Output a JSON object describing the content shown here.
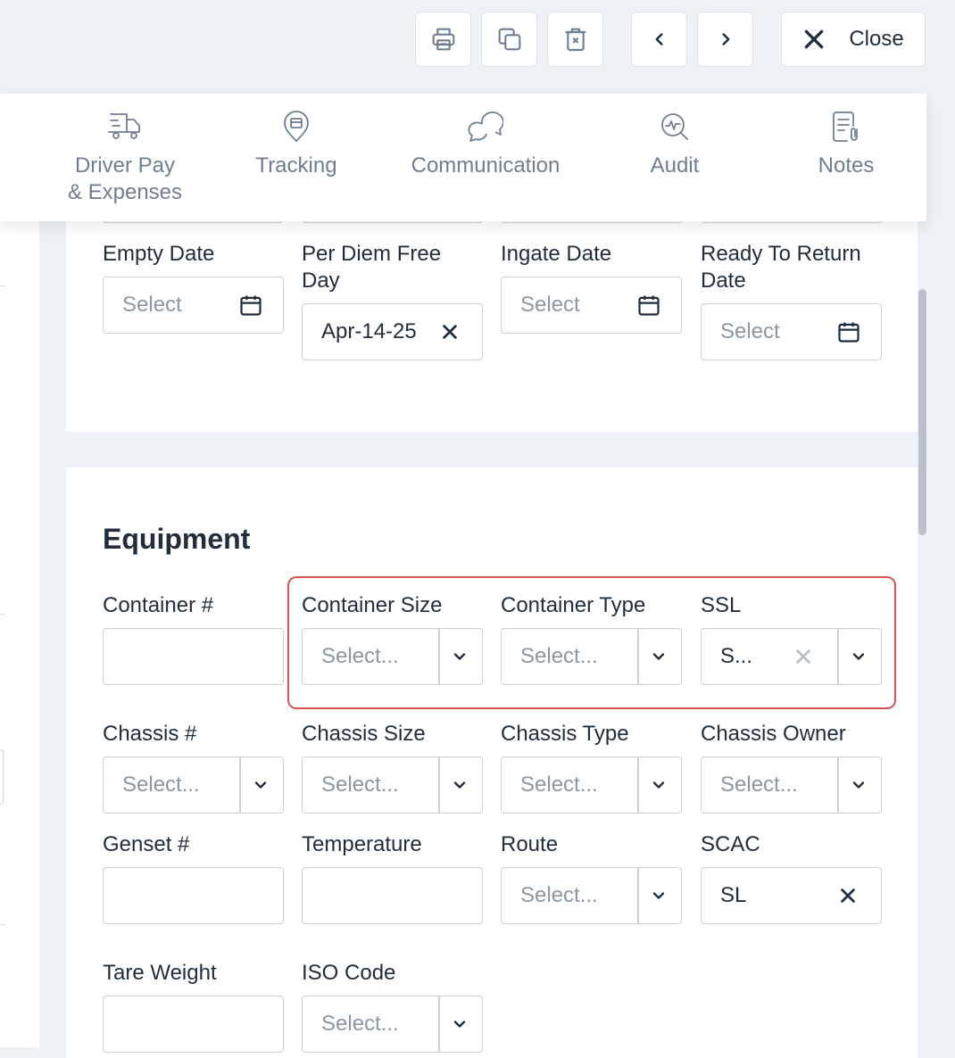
{
  "toolbar": {
    "print_icon": "printer-icon",
    "duplicate_icon": "copy-icon",
    "delete_icon": "trash-icon",
    "prev_icon": "chevron-left-icon",
    "next_icon": "chevron-right-icon",
    "close_label": "Close"
  },
  "tabs": [
    {
      "label": "Driver Pay\n& Expenses",
      "icon": "truck-icon"
    },
    {
      "label": "Tracking",
      "icon": "location-pin-icon"
    },
    {
      "label": "Communication",
      "icon": "chat-bubbles-icon"
    },
    {
      "label": "Audit",
      "icon": "magnifier-activity-icon"
    },
    {
      "label": "Notes",
      "icon": "note-clip-icon"
    }
  ],
  "dates": {
    "empty_date": {
      "label": "Empty Date",
      "placeholder": "Select"
    },
    "per_diem_free_day": {
      "label": "Per Diem Free\nDay",
      "value": "Apr-14-25"
    },
    "ingate_date": {
      "label": "Ingate Date",
      "placeholder": "Select"
    },
    "ready_to_return_date": {
      "label": "Ready To Return\nDate",
      "placeholder": "Select"
    }
  },
  "equipment": {
    "title": "Equipment",
    "container_number": {
      "label": "Container #",
      "value": ""
    },
    "container_size": {
      "label": "Container Size",
      "placeholder": "Select..."
    },
    "container_type": {
      "label": "Container Type",
      "placeholder": "Select..."
    },
    "ssl": {
      "label": "SSL",
      "value": "S..."
    },
    "chassis_number": {
      "label": "Chassis #",
      "placeholder": "Select..."
    },
    "chassis_size": {
      "label": "Chassis Size",
      "placeholder": "Select..."
    },
    "chassis_type": {
      "label": "Chassis Type",
      "placeholder": "Select..."
    },
    "chassis_owner": {
      "label": "Chassis Owner",
      "placeholder": "Select..."
    },
    "genset_number": {
      "label": "Genset #",
      "value": ""
    },
    "temperature": {
      "label": "Temperature",
      "value": ""
    },
    "route": {
      "label": "Route",
      "placeholder": "Select..."
    },
    "scac": {
      "label": "SCAC",
      "value": "SL"
    },
    "tare_weight": {
      "label": "Tare Weight",
      "value": ""
    },
    "iso_code": {
      "label": "ISO Code",
      "placeholder": "Select..."
    }
  },
  "colors": {
    "highlight_border": "#d9534f",
    "text_primary": "#1f2d3d",
    "text_muted": "#6e7f91",
    "placeholder": "#8a97a5",
    "input_border": "#c9d0d8"
  }
}
